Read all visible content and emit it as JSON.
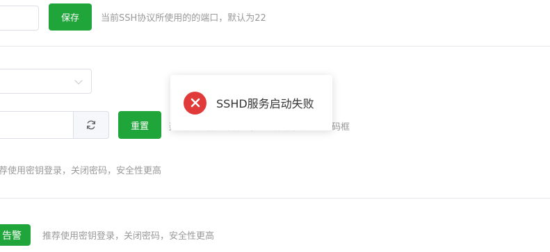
{
  "port_row": {
    "save_label": "保存",
    "hint": "当前SSH协议所使用的的端口，默认为22"
  },
  "password_row": {
    "reset_label": "重置",
    "hint": "建议复制后立即保存，刷新页面会清空密码框",
    "refresh_icon": "refresh-icon"
  },
  "key_row": {
    "hint": "荐使用密钥登录，关闭密码，安全性更高"
  },
  "alarm_row": {
    "button_label": "告警",
    "hint": "推荐使用密钥登录，关闭密码，安全性更高"
  },
  "toast": {
    "message": "SSHD服务启动失败",
    "type": "error",
    "icon": "close-circle-icon",
    "color": "#e03a3a"
  },
  "colors": {
    "primary": "#20a53a",
    "hint": "#999999",
    "border": "#dcdfe6",
    "error": "#e03a3a"
  }
}
